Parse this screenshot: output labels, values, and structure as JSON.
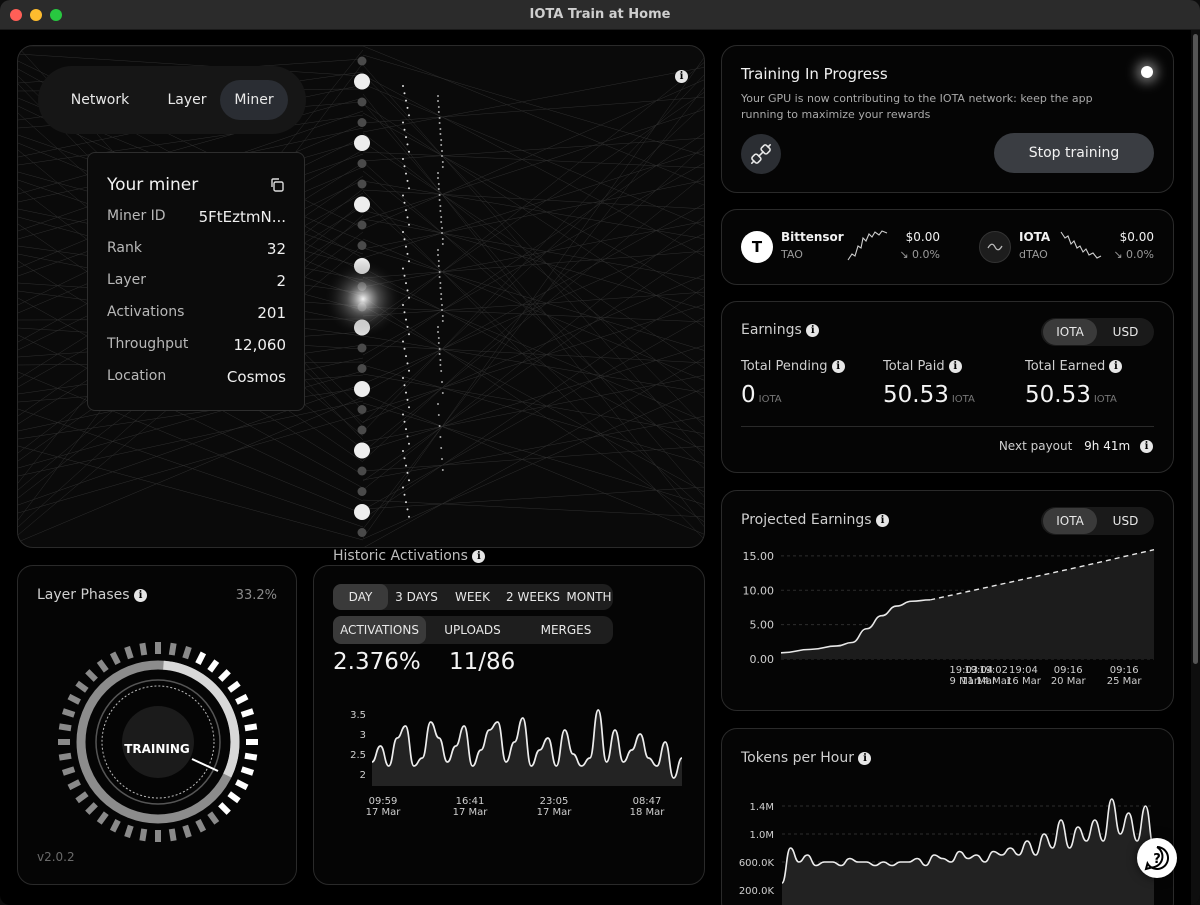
{
  "window": {
    "title": "IOTA Train at Home"
  },
  "tabs": [
    {
      "label": "Network"
    },
    {
      "label": "Layer"
    },
    {
      "label": "Miner"
    }
  ],
  "miner": {
    "title": "Your miner",
    "rows": [
      {
        "label": "Miner ID",
        "value": "5FtEztmN..."
      },
      {
        "label": "Rank",
        "value": "32"
      },
      {
        "label": "Layer",
        "value": "2"
      },
      {
        "label": "Activations",
        "value": "201"
      },
      {
        "label": "Throughput",
        "value": "12,060"
      },
      {
        "label": "Location",
        "value": "Cosmos"
      }
    ]
  },
  "training": {
    "title": "Training In Progress",
    "desc_1": "Your GPU is now contributing to the IOTA network: keep the app",
    "desc_2": "running to maximize your rewards",
    "stop_label": "Stop training"
  },
  "tickers": [
    {
      "name": "Bittensor",
      "symbol": "TAO",
      "badge": "T",
      "price": "$0.00",
      "change": "↘ 0.0%"
    },
    {
      "name": "IOTA",
      "symbol": "dTAO",
      "badge": "",
      "price": "$0.00",
      "change": "↘ 0.0%"
    }
  ],
  "earnings": {
    "title": "Earnings",
    "toggle": [
      "IOTA",
      "USD"
    ],
    "stats": [
      {
        "label": "Total Pending",
        "value": "0",
        "unit": "IOTA"
      },
      {
        "label": "Total Paid",
        "value": "50.53",
        "unit": "IOTA"
      },
      {
        "label": "Total Earned",
        "value": "50.53",
        "unit": "IOTA"
      }
    ],
    "next_payout_label": "Next payout",
    "next_payout_value": "9h 41m"
  },
  "projected": {
    "title": "Projected Earnings",
    "toggle": [
      "IOTA",
      "USD"
    ]
  },
  "tokens": {
    "title": "Tokens per Hour"
  },
  "layer_phases": {
    "title": "Layer Phases",
    "percent": "33.2%",
    "center": "TRAINING",
    "version": "v2.0.2"
  },
  "historic": {
    "title": "Historic Activations",
    "ranges": [
      "DAY",
      "3 DAYS",
      "WEEK",
      "2 WEEKS",
      "MONTH"
    ],
    "metrics": [
      "ACTIVATIONS",
      "UPLOADS",
      "MERGES"
    ],
    "activation_pct": "2.376%",
    "uploads": "11/86"
  },
  "chart_data": [
    {
      "type": "area",
      "title": "Projected Earnings",
      "ylim": [
        0,
        16
      ],
      "y_ticks": [
        "15.00",
        "10.00",
        "5.00",
        "0.00"
      ],
      "x_tick_labels": [
        [
          "19:03",
          "9 Mar"
        ],
        [
          "19:04",
          "11 Mar"
        ],
        [
          "19:02",
          "14 Mar"
        ],
        [
          "19:04",
          "16 Mar"
        ],
        [
          "09:16",
          "20 Mar"
        ],
        [
          "09:16",
          "25 Mar"
        ]
      ],
      "series": [
        {
          "values": [
            [
              0,
              0.9
            ],
            [
              8,
              1.4
            ],
            [
              15,
              1.9
            ],
            [
              19,
              2.4
            ],
            [
              23,
              4.4
            ],
            [
              27,
              6.3
            ],
            [
              31,
              7.7
            ],
            [
              35,
              8.4
            ],
            [
              40,
              8.6
            ]
          ]
        },
        {
          "values": [
            [
              40,
              8.6
            ],
            [
              60,
              11.0
            ],
            [
              80,
              13.4
            ],
            [
              100,
              15.9
            ]
          ]
        }
      ]
    },
    {
      "type": "area",
      "title": "Historic Activations",
      "ylim": [
        1.7,
        3.8
      ],
      "y_ticks": [
        "3.5",
        "3",
        "2.5",
        "2"
      ],
      "x_tick_labels": [
        [
          "09:59",
          "17 Mar"
        ],
        [
          "16:41",
          "17 Mar"
        ],
        [
          "23:05",
          "17 Mar"
        ],
        [
          "08:47",
          "18 Mar"
        ]
      ],
      "series": [
        {
          "values": [
            2.3,
            2.7,
            2.2,
            2.9,
            3.2,
            2.2,
            2.4,
            3.3,
            2.9,
            2.3,
            2.7,
            3.2,
            2.2,
            2.6,
            3.1,
            3.3,
            2.3,
            2.8,
            3.4,
            2.2,
            2.6,
            2.9,
            2.2,
            3.1,
            2.5,
            2.2,
            2.4,
            3.6,
            2.3,
            3.1,
            2.3,
            2.6,
            3.0,
            2.4,
            2.2,
            2.8,
            1.9,
            2.4
          ]
        }
      ]
    },
    {
      "type": "area",
      "title": "Tokens per Hour",
      "ylim": [
        0,
        1.6
      ],
      "y_ticks": [
        "1.4M",
        "1.0M",
        "600.0K",
        "200.0K"
      ],
      "series": [
        {
          "values": [
            0.3,
            0.8,
            0.6,
            0.7,
            0.55,
            0.6,
            0.6,
            0.55,
            0.65,
            0.6,
            0.6,
            0.55,
            0.6,
            0.55,
            0.6,
            0.6,
            0.65,
            0.55,
            0.7,
            0.65,
            0.6,
            0.75,
            0.65,
            0.7,
            0.6,
            0.75,
            0.7,
            0.8,
            0.7,
            0.9,
            0.7,
            1.0,
            0.8,
            1.2,
            0.8,
            1.1,
            0.9,
            1.2,
            0.9,
            1.5,
            1.0,
            1.3,
            0.9,
            1.4,
            0.8
          ]
        }
      ]
    }
  ]
}
